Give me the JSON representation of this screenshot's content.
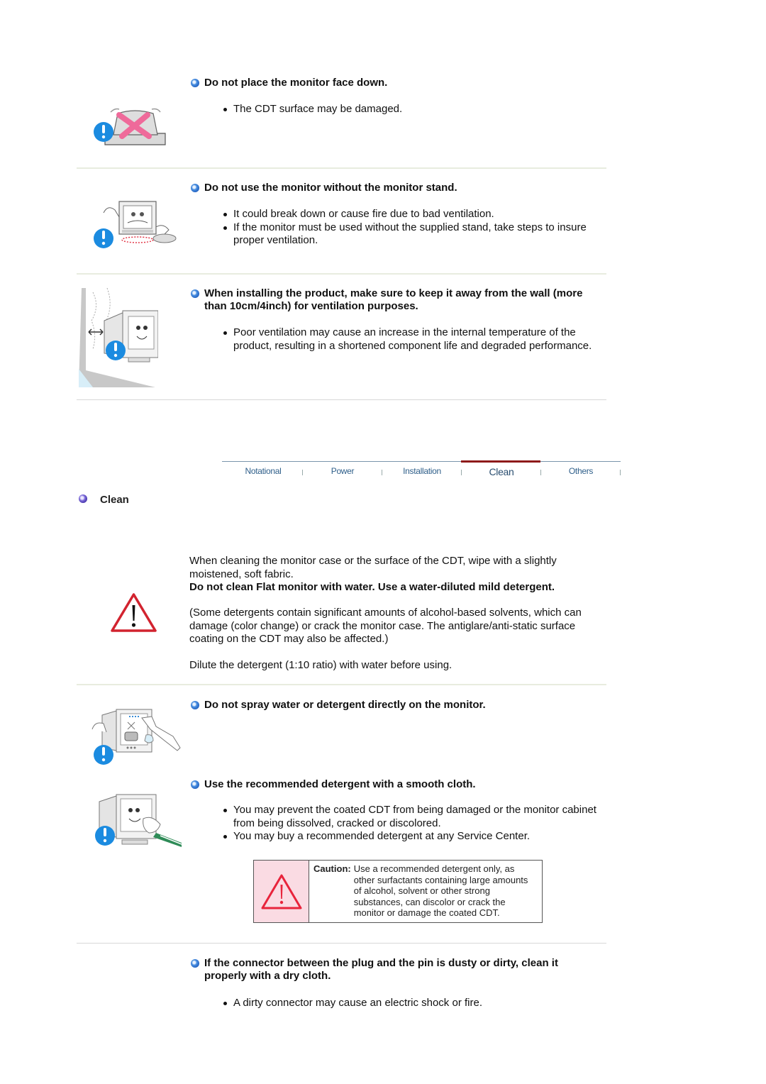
{
  "sections_top": [
    {
      "heading": "Do not place the monitor face down.",
      "bullets": [
        "The CDT surface may be damaged."
      ]
    },
    {
      "heading": "Do not use the monitor without the monitor stand.",
      "bullets": [
        "It could break down or cause fire due to bad ventilation.",
        "If the monitor must be used without the supplied stand, take steps to insure proper ventilation."
      ]
    },
    {
      "heading": "When installing the product, make sure to keep it away from the wall (more than 10cm/4inch) for ventilation purposes.",
      "bullets": [
        "Poor ventilation may cause an increase in the internal temperature of the product, resulting in a shortened component life and degraded performance."
      ]
    }
  ],
  "nav": {
    "tabs": [
      "Notational",
      "Power",
      "Installation",
      "Clean",
      "Others"
    ],
    "active": "Clean",
    "active_color": "#8e1a1a"
  },
  "clean_section": {
    "title": "Clean",
    "intro": "When cleaning the monitor case or the surface of the CDT, wipe with a slightly moistened, soft fabric.",
    "warning_bold": "Do not clean Flat monitor with water. Use a water-diluted mild detergent.",
    "detergent_note": "(Some detergents contain significant amounts of alcohol-based solvents, which can damage (color change) or crack the monitor case. The antiglare/anti-static surface coating on the CDT may also be affected.)",
    "dilute_note": "Dilute the detergent (1:10 ratio) with water before using."
  },
  "sections_bottom": [
    {
      "heading": "Do not spray water or detergent directly on the monitor.",
      "bullets": []
    },
    {
      "heading": "Use the recommended detergent with a smooth cloth.",
      "bullets": [
        "You may prevent the coated CDT from being damaged or the monitor cabinet from being dissolved, cracked or discolored.",
        "You may buy a recommended detergent at any Service Center."
      ]
    },
    {
      "heading": "If the connector between the plug and the pin is dusty or dirty, clean it properly with a dry cloth.",
      "bullets": [
        "A dirty connector may cause an electric shock or fire."
      ]
    }
  ],
  "caution": {
    "label": "Caution:",
    "text": "Use a recommended detergent only, as other surfactants containing large amounts of alcohol, solvent or other strong substances, can discolor or crack the monitor or damage the coated CDT."
  }
}
